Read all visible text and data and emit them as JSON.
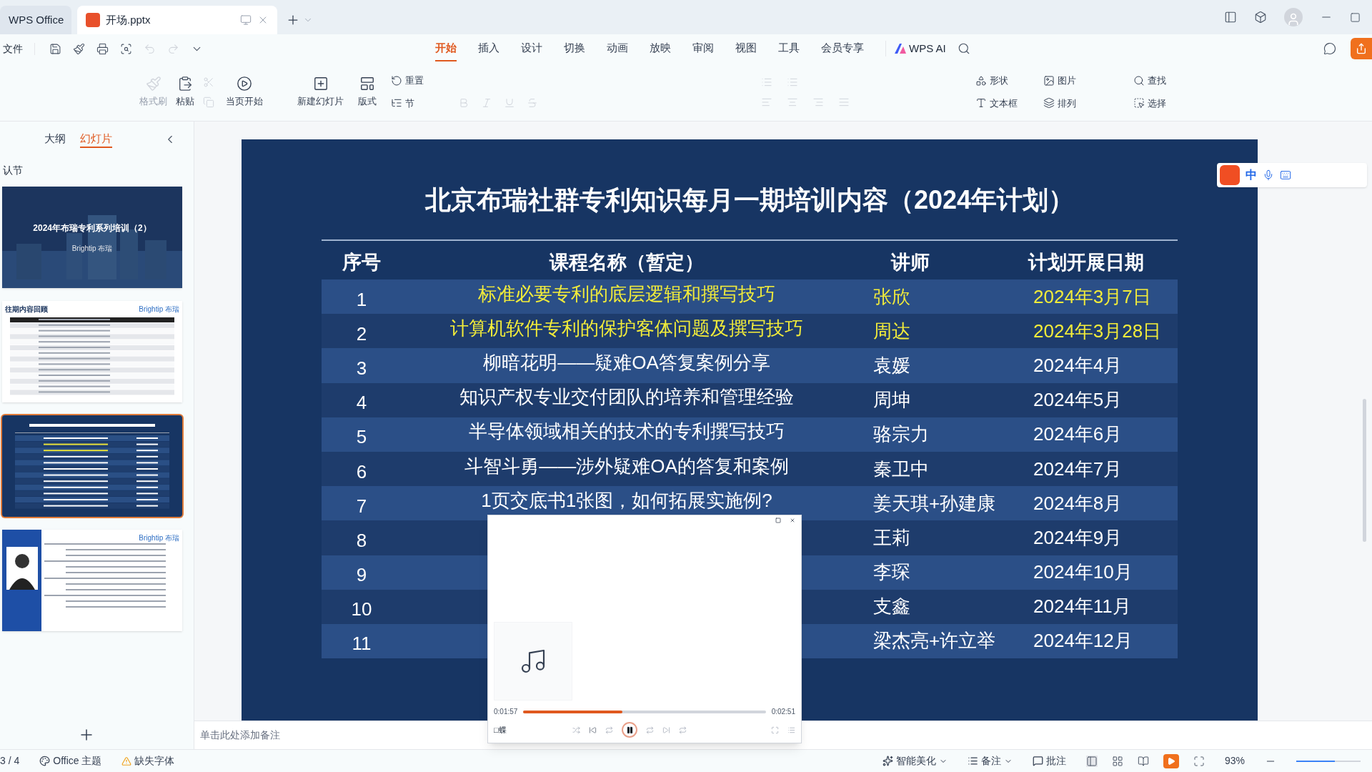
{
  "doc_tabs": [
    {
      "label": "WPS Office",
      "kind": "home",
      "selected": false
    },
    {
      "label": "开场.pptx",
      "kind": "file",
      "selected": true
    }
  ],
  "menu": {
    "file": "文件",
    "tabs": [
      {
        "label": "开始",
        "selected": true
      },
      {
        "label": "插入",
        "selected": false
      },
      {
        "label": "设计",
        "selected": false
      },
      {
        "label": "切换",
        "selected": false
      },
      {
        "label": "动画",
        "selected": false
      },
      {
        "label": "放映",
        "selected": false
      },
      {
        "label": "审阅",
        "selected": false
      },
      {
        "label": "视图",
        "selected": false
      },
      {
        "label": "工具",
        "selected": false
      },
      {
        "label": "会员专享",
        "selected": false
      }
    ],
    "ai": "WPS AI"
  },
  "ribbon": {
    "format_painter": {
      "label": "格式刷",
      "disabled": true
    },
    "paste": "粘贴",
    "play": "当页开始",
    "new_slide": "新建幻灯片",
    "layout": "版式",
    "reset": "重置",
    "section": "节",
    "shape": "形状",
    "picture": "图片",
    "textbox": "文本框",
    "arrange": "排列",
    "find": "查找",
    "select": "选择"
  },
  "sidebar": {
    "tabs": [
      {
        "label": "大纲",
        "selected": false
      },
      {
        "label": "幻灯片",
        "selected": true
      }
    ],
    "section": "认节",
    "thumbnails": [
      {
        "kind": "cover",
        "title": "2024年布瑞专利系列培训（2）",
        "brand": "Brightip 布瑞",
        "selected": false
      },
      {
        "kind": "table",
        "title": "往期内容回顾",
        "brand": "Brightip 布瑞",
        "selected": false
      },
      {
        "kind": "plan",
        "selected": true
      },
      {
        "kind": "profile",
        "brand": "Brightip 布瑞",
        "selected": false
      }
    ]
  },
  "slide": {
    "title": "北京布瑞社群专利知识每月一期培训内容（2024年计划）",
    "columns": [
      "序号",
      "课程名称（暂定）",
      "讲师",
      "计划开展日期"
    ],
    "rows": [
      {
        "no": "1",
        "course": "标准必要专利的底层逻辑和撰写技巧",
        "teacher": "张欣",
        "date": "2024年3月7日",
        "highlighted": true
      },
      {
        "no": "2",
        "course": "计算机软件专利的保护客体问题及撰写技巧",
        "teacher": "周达",
        "date": "2024年3月28日",
        "highlighted": true
      },
      {
        "no": "3",
        "course": "柳暗花明——疑难OA答复案例分享",
        "teacher": "袁媛",
        "date": "2024年4月",
        "highlighted": false
      },
      {
        "no": "4",
        "course": "知识产权专业交付团队的培养和管理经验",
        "teacher": "周坤",
        "date": "2024年5月",
        "highlighted": false
      },
      {
        "no": "5",
        "course": "半导体领域相关的技术的专利撰写技巧",
        "teacher": "骆宗力",
        "date": "2024年6月",
        "highlighted": false
      },
      {
        "no": "6",
        "course": "斗智斗勇——涉外疑难OA的答复和案例",
        "teacher": "秦卫中",
        "date": "2024年7月",
        "highlighted": false
      },
      {
        "no": "7",
        "course": "1页交底书1张图，如何拓展实施例?",
        "teacher": "姜天琪+孙建康",
        "date": "2024年8月",
        "highlighted": false
      },
      {
        "no": "8",
        "teacher": "王莉",
        "date": "2024年9月",
        "highlighted": false
      },
      {
        "no": "9",
        "teacher": "李琛",
        "date": "2024年10月",
        "highlighted": false
      },
      {
        "no": "10",
        "teacher": "支鑫",
        "date": "2024年11月",
        "highlighted": false
      },
      {
        "no": "11",
        "teacher": "梁杰亮+许立举",
        "date": "2024年12月",
        "highlighted": false
      }
    ]
  },
  "notes": {
    "placeholder": "单击此处添加备注"
  },
  "player": {
    "elapsed": "0:01:57",
    "total": "0:02:51",
    "track": "□蝶",
    "level": 0.41,
    "playing": true
  },
  "ime": {
    "mode": "中"
  },
  "status_bar": {
    "page": "3 / 4",
    "theme": "Office 主题",
    "missing_fonts": "缺失字体",
    "beautify": "智能美化",
    "notes": "备注",
    "comments": "批注",
    "zoom": "93%",
    "zoom_level": {
      "level": 0.6
    }
  }
}
